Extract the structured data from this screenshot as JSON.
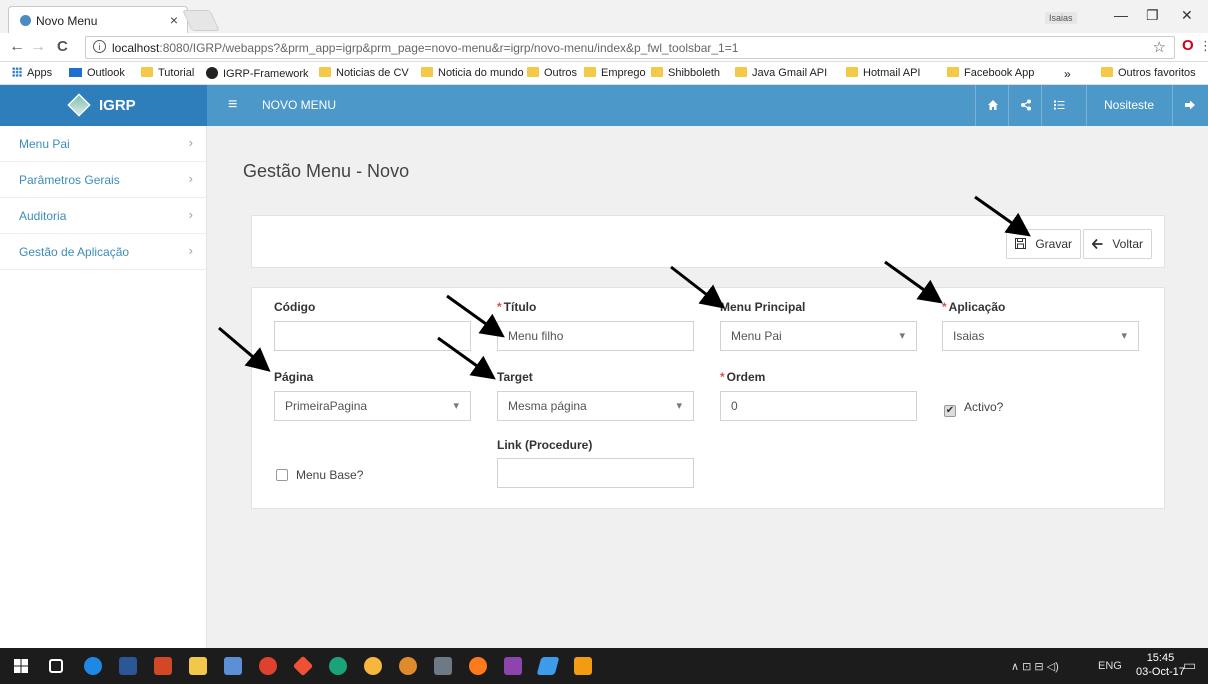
{
  "browser": {
    "tab_title": "Novo Menu",
    "tab_close": "×",
    "user_badge": "Isaias",
    "back": "←",
    "forward": "→",
    "reload": "C",
    "info": "i",
    "url_host": "localhost",
    "url_rest": ":8080/IGRP/webapps?&prm_app=igrp&prm_page=novo-menu&r=igrp/novo-menu/index&p_fwl_toolsbar_1=1",
    "star": "☆",
    "minimize": "—",
    "restore": "❐",
    "close": "✕",
    "opera": "O",
    "menu": "⋮",
    "bookmarks": [
      "Apps",
      "Outlook",
      "Tutorial",
      "IGRP-Framework",
      "Noticias de CV",
      "Noticia do mundo",
      "Outros",
      "Emprego",
      "Shibboleth",
      "Java Gmail API",
      "Hotmail API",
      "Facebook App"
    ],
    "more": "»",
    "other_bookmarks": "Outros favoritos"
  },
  "app": {
    "brand": "IGRP",
    "hamburger": "≡",
    "page_name": "NOVO MENU",
    "user": "Nositeste",
    "icons": [
      "home-icon",
      "share-icon",
      "list-icon",
      "logout-icon"
    ]
  },
  "sidebar": {
    "items": [
      {
        "label": "Menu Pai",
        "chev": "›"
      },
      {
        "label": "Parâmetros Gerais",
        "chev": "›"
      },
      {
        "label": "Auditoria",
        "chev": "›"
      },
      {
        "label": "Gestão de Aplicação",
        "chev": "›"
      }
    ]
  },
  "main": {
    "title": "Gestão Menu - Novo",
    "buttons": {
      "save": "Gravar",
      "back": "Voltar"
    },
    "form": {
      "codigo": {
        "label": "Código",
        "value": ""
      },
      "titulo": {
        "label": "Título",
        "value": "Menu filho",
        "required": "*"
      },
      "menu_principal": {
        "label": "Menu Principal",
        "value": "Menu Pai"
      },
      "aplicacao": {
        "label": "Aplicação",
        "value": "Isaias",
        "required": "*"
      },
      "pagina": {
        "label": "Página",
        "value": "PrimeiraPagina"
      },
      "target": {
        "label": "Target",
        "value": "Mesma página"
      },
      "ordem": {
        "label": "Ordem",
        "value": "0",
        "required": "*"
      },
      "activo": {
        "label": "Activo?",
        "checked": true
      },
      "link": {
        "label": "Link (Procedure)",
        "value": ""
      },
      "menu_base": {
        "label": "Menu Base?",
        "checked": false
      }
    }
  },
  "taskbar": {
    "lang": "ENG",
    "time": "15:45",
    "date": "03-Oct-17"
  },
  "colors": {
    "header": "#4b98c9",
    "brand": "#2f7ebc",
    "link": "#3c8dbc",
    "required": "#d9534f"
  }
}
